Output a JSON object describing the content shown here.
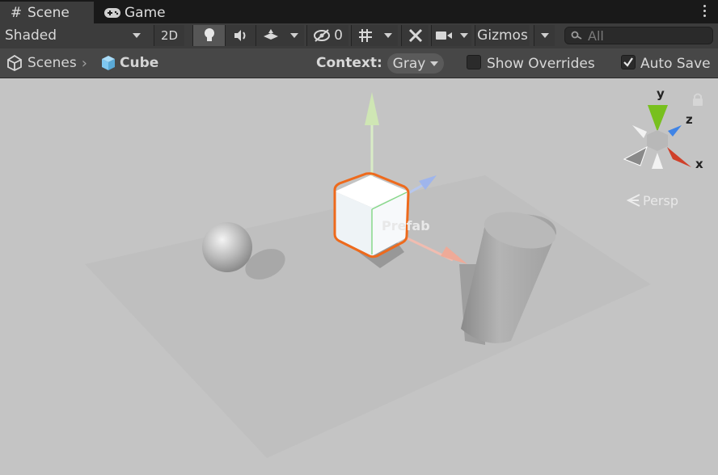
{
  "tabs": [
    {
      "label": "Scene",
      "icon": "grid-icon",
      "active": true
    },
    {
      "label": "Game",
      "icon": "gamepad-icon",
      "active": false
    }
  ],
  "toolbar": {
    "draw_mode": "Shaded",
    "mode_2d": "2D",
    "hidden_count": "0",
    "gizmos": "Gizmos",
    "search_placeholder": "All"
  },
  "breadcrumb": {
    "root": "Scenes",
    "current": "Cube"
  },
  "context": {
    "label": "Context:",
    "value": "Gray"
  },
  "options": {
    "show_overrides": {
      "label": "Show Overrides",
      "checked": false
    },
    "auto_save": {
      "label": "Auto Save",
      "checked": true
    }
  },
  "viewport": {
    "prefab_label": "Prefab",
    "projection": "Persp",
    "axes": {
      "x": "x",
      "y": "y",
      "z": "z"
    }
  },
  "colors": {
    "accent_orange": "#ee6a1c",
    "axis_x": "#e0402a",
    "axis_y": "#79c21e",
    "axis_z": "#3f84e6",
    "cube_icon": "#7fc7f0"
  }
}
